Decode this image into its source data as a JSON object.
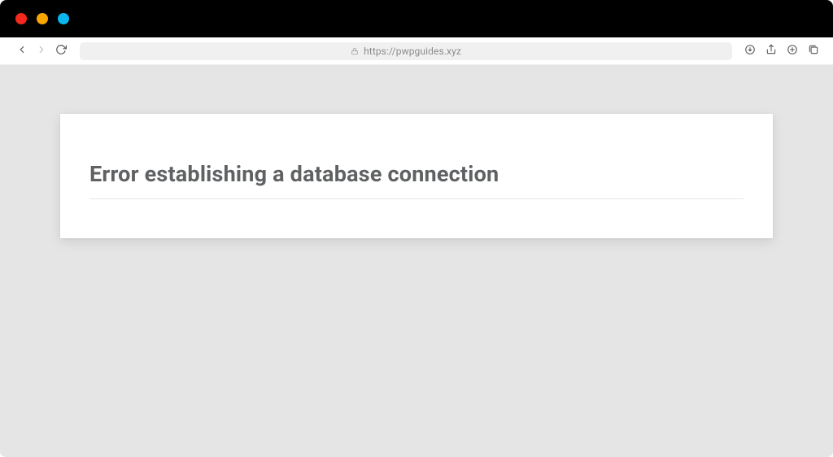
{
  "window": {
    "traffic": {
      "close": "close",
      "minimize": "minimize",
      "zoom": "zoom"
    }
  },
  "toolbar": {
    "url": "https://pwpguides.xyz"
  },
  "page": {
    "heading": "Error establishing a database connection"
  }
}
